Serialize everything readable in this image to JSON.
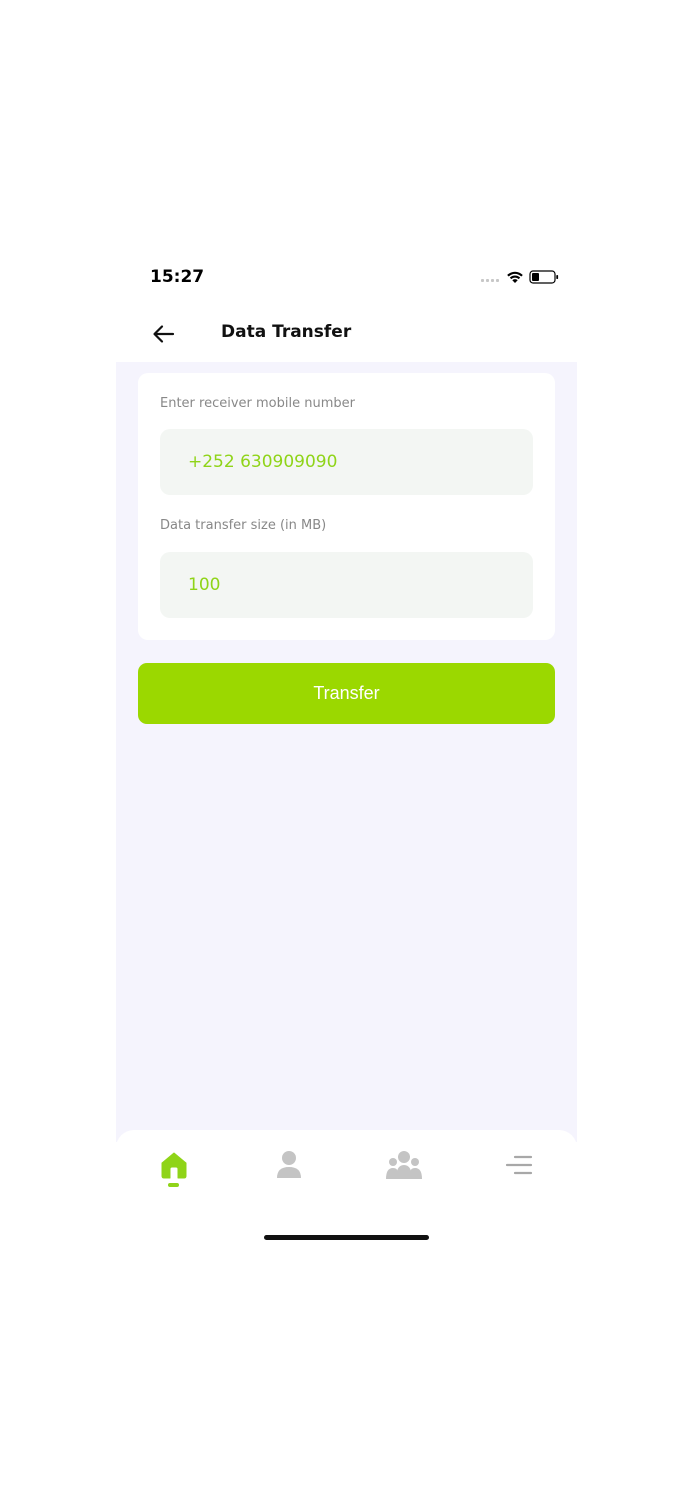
{
  "status_bar": {
    "time": "15:27"
  },
  "header": {
    "title": "Data Transfer",
    "back_icon": "arrow-left-icon"
  },
  "form": {
    "receiver_label": "Enter receiver mobile number",
    "receiver_value": "+252 630909090",
    "size_label": "Data transfer size (in MB)",
    "size_value": "100"
  },
  "actions": {
    "transfer_label": "Transfer"
  },
  "bottom_nav": {
    "items": [
      {
        "icon": "home-icon",
        "active": true
      },
      {
        "icon": "user-icon",
        "active": false
      },
      {
        "icon": "group-icon",
        "active": false
      },
      {
        "icon": "menu-icon",
        "active": false
      }
    ]
  },
  "colors": {
    "accent": "#9bd800",
    "input_text": "#8fd418",
    "background": "#f5f4fd",
    "inactive_icon": "#c4c4c4"
  }
}
